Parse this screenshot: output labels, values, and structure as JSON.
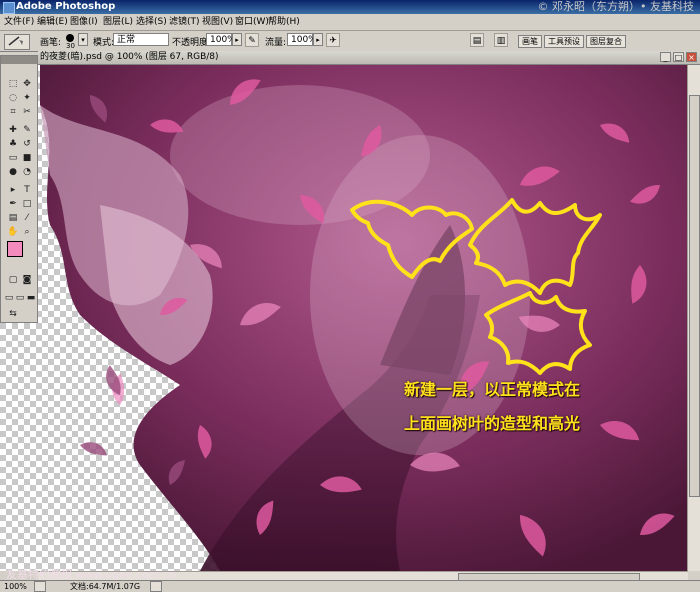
{
  "window": {
    "app_title": "Adobe Photoshop",
    "copyright": "© 邓永昭（东方朔）• 友基科技"
  },
  "menu": [
    "文件(F)",
    "编辑(E)",
    "图像(I)",
    "图层(L)",
    "选择(S)",
    "滤镜(T)",
    "视图(V)",
    "窗口(W)",
    "帮助(H)"
  ],
  "options": {
    "brush_label": "画笔:",
    "brush_size": "30",
    "mode_label": "模式:",
    "mode_value": "正常",
    "opacity_label": "不透明度:",
    "opacity_value": "100%",
    "flow_label": "流量:",
    "flow_value": "100%",
    "palette_tabs": [
      "画笔",
      "工具预设",
      "图层复合"
    ]
  },
  "document": {
    "title": "的夜菱(暗).psd @ 100% (图层 67, RGB/8)"
  },
  "caption": {
    "line1": "新建一层，以正常模式在",
    "line2": "上面画树叶的造型和高光"
  },
  "status": {
    "zoom": "100%",
    "doc_size": "文档:64.7M/1.07G"
  },
  "watermark": "友基特约教程  www.ugee.com.cn",
  "colors": {
    "foreground": "#f48bbd",
    "background": "#ffffff",
    "highlight_outline": "#ffe21a"
  }
}
